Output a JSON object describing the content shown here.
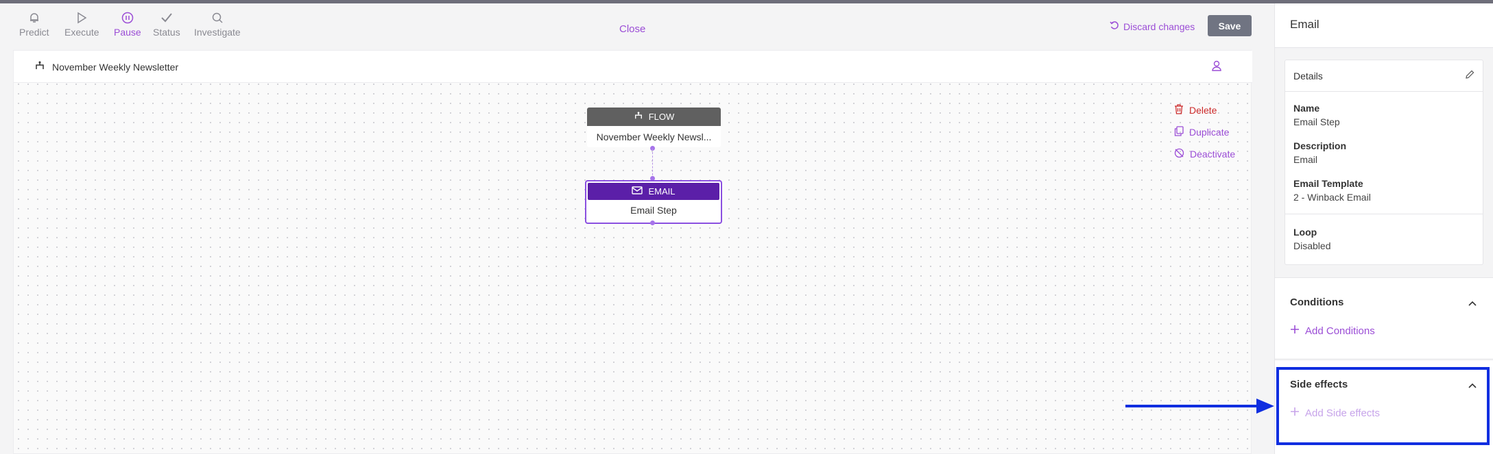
{
  "toolbar": {
    "items": [
      {
        "label": "Predict",
        "icon": "bell-icon"
      },
      {
        "label": "Execute",
        "icon": "play-icon"
      },
      {
        "label": "Pause",
        "icon": "pause-icon"
      },
      {
        "label": "Status",
        "icon": "check-icon"
      },
      {
        "label": "Investigate",
        "icon": "search-icon"
      }
    ],
    "active": "Pause",
    "close_label": "Close",
    "discard_label": "Discard changes",
    "save_label": "Save"
  },
  "flow": {
    "title": "November Weekly Newsletter",
    "nodes": [
      {
        "type_label": "FLOW",
        "name": "November Weekly Newsl..."
      },
      {
        "type_label": "EMAIL",
        "name": "Email Step"
      }
    ],
    "actions": {
      "delete": "Delete",
      "duplicate": "Duplicate",
      "deactivate": "Deactivate"
    }
  },
  "panel": {
    "title": "Email",
    "details": {
      "header": "Details",
      "fields": [
        {
          "label": "Name",
          "value": "Email Step"
        },
        {
          "label": "Description",
          "value": "Email"
        },
        {
          "label": "Email Template",
          "value": "2 - Winback Email"
        },
        {
          "label": "Loop",
          "value": "Disabled"
        }
      ]
    },
    "conditions": {
      "title": "Conditions",
      "add_label": "Add Conditions"
    },
    "side_effects": {
      "title": "Side effects",
      "add_label": "Add Side effects"
    }
  },
  "colors": {
    "accent": "#9b4dd6",
    "email_node": "#5b1fa8",
    "flow_node": "#606060",
    "danger": "#cc2a2a",
    "highlight": "#0f2ee0"
  }
}
